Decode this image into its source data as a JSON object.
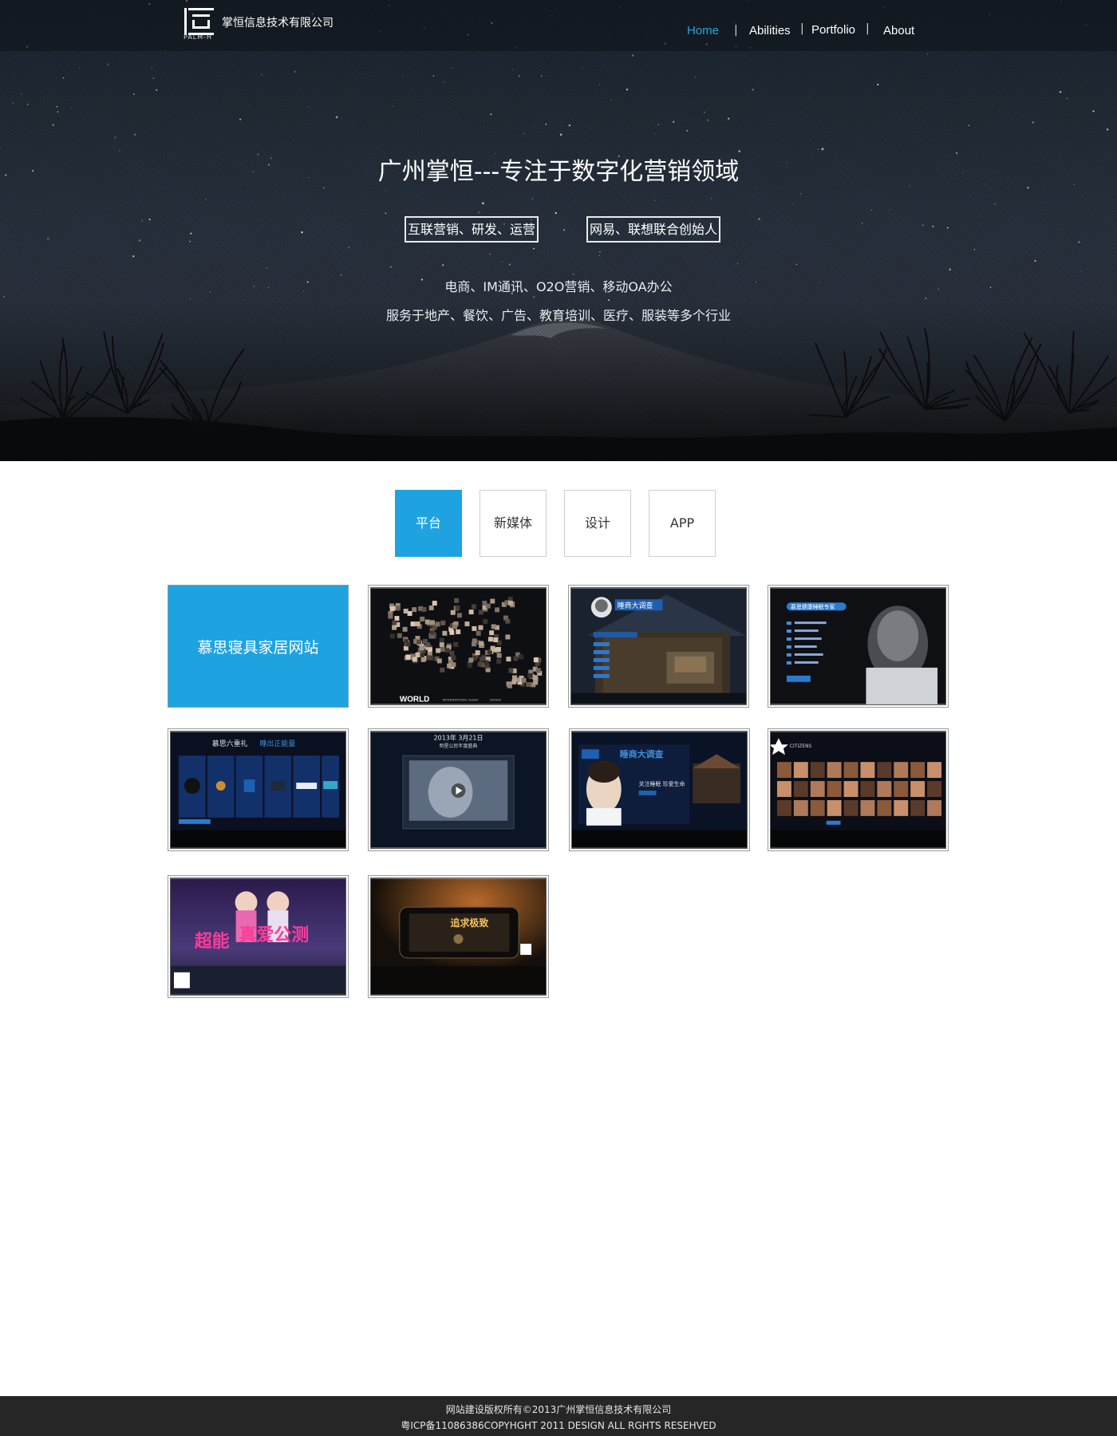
{
  "header": {
    "logo_text": "PALM-H",
    "company_name": "掌恒信息技术有限公司",
    "nav": [
      {
        "label": "Home",
        "active": true
      },
      {
        "label": "Abilities",
        "active": false
      },
      {
        "label": "Portfolio",
        "active": false
      },
      {
        "label": "About",
        "active": false
      }
    ],
    "nav_separator": "|"
  },
  "hero": {
    "title": "广州掌恒---专注于数字化营销领域",
    "tags": [
      "互联营销、研发、运营",
      "网易、联想联合创始人"
    ],
    "line1": "电商、IM通讯、O2O营销、移动OA办公",
    "line2": "服务于地产、餐饮、广告、教育培训、医疗、服装等多个行业"
  },
  "tabs": [
    {
      "label": "平台",
      "active": true
    },
    {
      "label": "新媒体",
      "active": false
    },
    {
      "label": "设计",
      "active": false
    },
    {
      "label": "APP",
      "active": false
    }
  ],
  "portfolio": {
    "feature_label": "慕思寝具家居网站",
    "thumbnails": [
      {
        "name": "world-map-photos",
        "texts": [
          "WORLD",
          "INTERNATIONAL SLEEP",
          "ENTER"
        ]
      },
      {
        "name": "sleep-survey-room",
        "texts": [
          "睡商大调查"
        ]
      },
      {
        "name": "sleep-expert",
        "texts": [
          "慕思健康睡眠专家"
        ]
      },
      {
        "name": "six-gifts",
        "texts": [
          "慕思六重礼",
          "睡出正能量"
        ]
      },
      {
        "name": "video-event",
        "texts": [
          "2013年 3月21日",
          "明星公民年度盛典"
        ]
      },
      {
        "name": "sleep-survey-banner",
        "texts": [
          "睡商大调查",
          "关注睡眠 珍爱生命"
        ]
      },
      {
        "name": "citizens-grid",
        "texts": [
          "CITIZENS"
        ]
      },
      {
        "name": "love-test",
        "texts": [
          "超能",
          "真爱公测"
        ]
      },
      {
        "name": "mobile-promo",
        "texts": [
          "追求极致"
        ]
      }
    ]
  },
  "footer": {
    "line1": "网站建设版权所有©2013广州掌恒信息技术有限公司",
    "line2": "粤ICP备11086386COPYHGHT  2011  DESIGN  ALL RGHTS  RESEHVED"
  },
  "colors": {
    "accent": "#1ea3e0",
    "nav_active": "#23a4e3",
    "footer_bg": "#262626"
  }
}
